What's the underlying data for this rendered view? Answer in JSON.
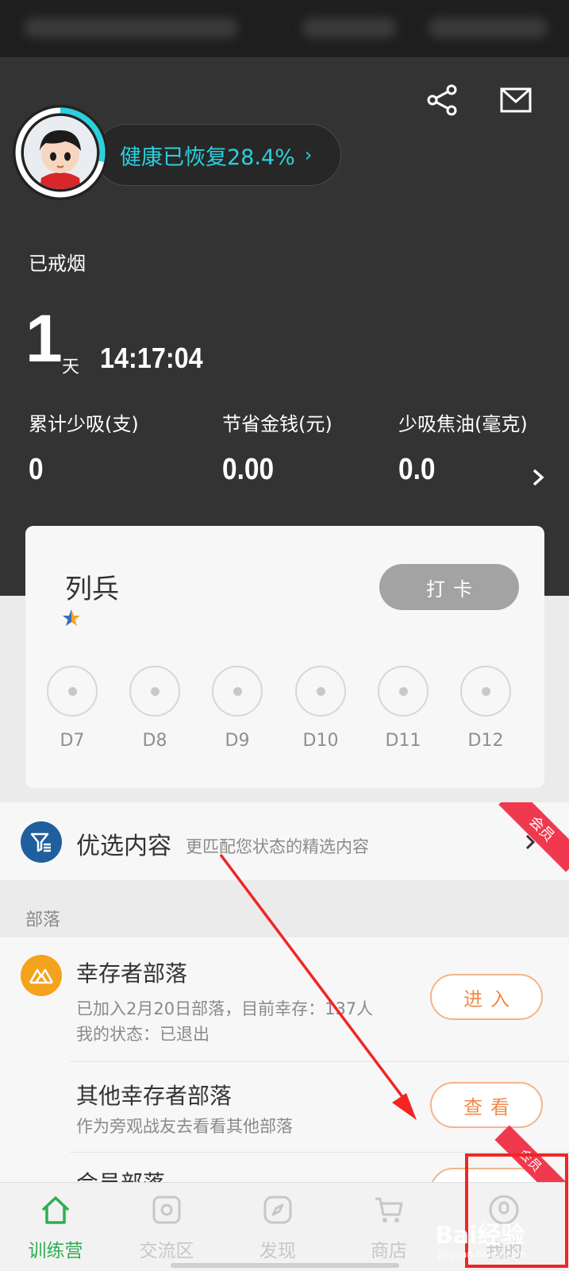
{
  "header": {
    "health_text": "健康已恢复28.4%",
    "health_chevron": "›",
    "health_progress": 0.284,
    "quit_label": "已戒烟",
    "days": "1",
    "days_unit": "天",
    "timer": "14:17:04",
    "stats": [
      {
        "label": "累计少吸(支)",
        "value": "0"
      },
      {
        "label": "节省金钱(元)",
        "value": "0.00"
      },
      {
        "label": "少吸焦油(毫克)",
        "value": "0.0"
      }
    ]
  },
  "rank_card": {
    "title": "列兵",
    "stars": 1,
    "checkin_label": "打卡",
    "days": [
      "D7",
      "D8",
      "D9",
      "D10",
      "D11",
      "D12"
    ]
  },
  "featured": {
    "title": "优选内容",
    "subtitle": "更匹配您状态的精选内容",
    "badge": "会员"
  },
  "section_label": "部落",
  "tribes": [
    {
      "title": "幸存者部落",
      "line1": "已加入2月20日部落，目前幸存：137人",
      "line2": "我的状态：已退出",
      "button": "进入"
    },
    {
      "title": "其他幸存者部落",
      "line1": "作为旁观战友去看看其他部落",
      "button": "查看"
    },
    {
      "title": "会员部落",
      "badge": "会员"
    }
  ],
  "tabs": [
    {
      "label": "训练营",
      "icon": "home-icon",
      "active": true
    },
    {
      "label": "交流区",
      "icon": "chat-icon",
      "active": false
    },
    {
      "label": "发现",
      "icon": "compass-icon",
      "active": false
    },
    {
      "label": "商店",
      "icon": "cart-icon",
      "active": false
    },
    {
      "label": "我的",
      "icon": "person-icon",
      "active": false
    }
  ],
  "watermark": "Bai经验",
  "watermark_sub": "jingyan.baidu.com",
  "colors": {
    "header_bg": "#333333",
    "accent_cyan": "#29d0de",
    "active_green": "#2eae52",
    "badge_red": "#f0384e",
    "orange": "#f08a4a"
  }
}
